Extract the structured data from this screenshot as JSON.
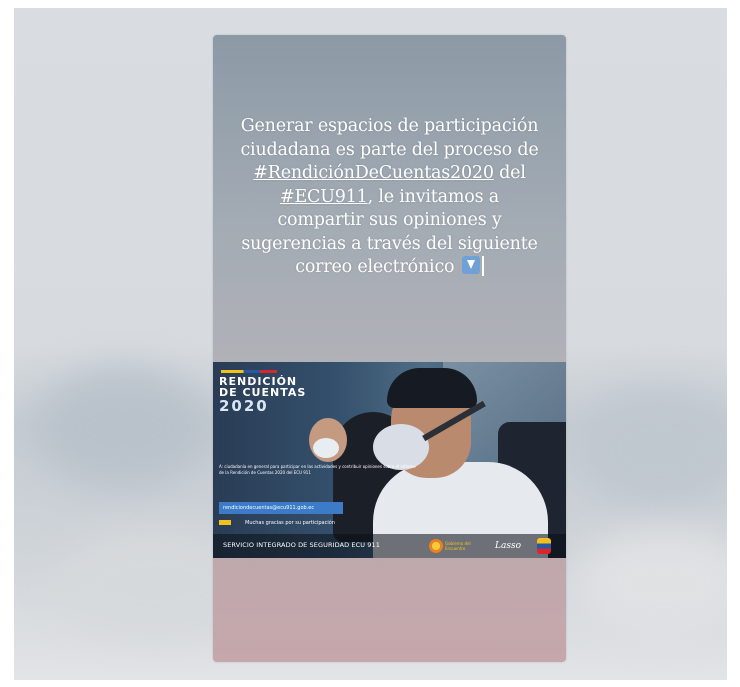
{
  "story": {
    "caption": {
      "line1": "Generar espacios de participación",
      "line2": "ciudadana es parte del proceso de",
      "hashtag1": "#RendiciónDeCuentas2020",
      "line3_tail": " del",
      "hashtag2": "#ECU911",
      "line4_tail": ", le invitamos a",
      "line5": "compartir sus opiniones y",
      "line6": "sugerencias a través del siguiente",
      "line7": "correo electrónico"
    },
    "arrow_icon": "down-arrow-emoji-icon"
  },
  "image": {
    "title_line1": "RENDICIÓN",
    "title_line2": "DE CUENTAS",
    "year": "2020",
    "body_text": "A: ciudadanía en general para participar en las actividades y contribuir opiniones sobre el informe de la Rendición de Cuentas 2020 del ECU 911",
    "email": "rendiciondecuentas@ecu911.gob.ec",
    "thanks": "Muchas gracias por su participación",
    "footer": "SERVICIO INTEGRADO DE SEGURIDAD ECU 911",
    "logo_word": "Gobierno del Encuentro",
    "logo_sign": "Lasso"
  },
  "colors": {
    "story_top": "#8c9aa6",
    "story_bottom": "#c6a7ab",
    "flag_yellow": "#f2c21a",
    "flag_blue": "#2a56a6",
    "flag_red": "#d8262e",
    "email_bar": "#3b7bc8"
  }
}
